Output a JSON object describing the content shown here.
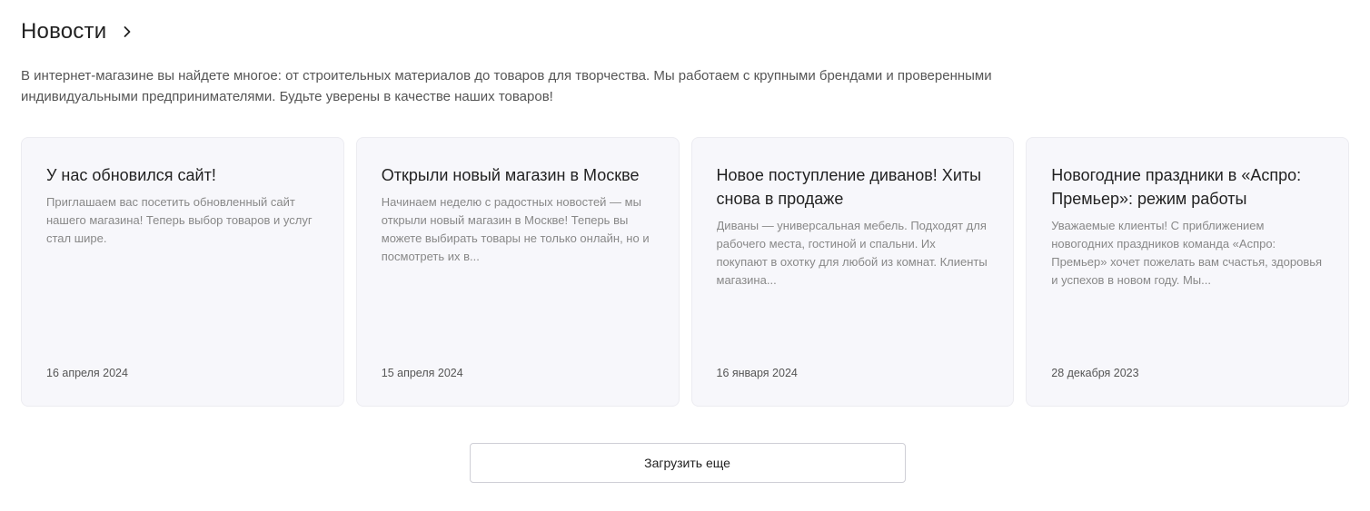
{
  "section": {
    "title": "Новости",
    "intro": "В интернет-магазине вы найдете многое: от строительных материалов до товаров для творчества. Мы работаем с крупными брендами и проверенными индивидуальными предпринимателями. Будьте уверены в качестве наших товаров!"
  },
  "icons": {
    "header_arrow": "chevron-right-icon"
  },
  "news": [
    {
      "title": "У нас обновился сайт!",
      "text": "Приглашаем вас посетить обновленный сайт нашего магазина! Теперь выбор товаров и услуг стал шире.",
      "date": "16 апреля 2024"
    },
    {
      "title": "Открыли новый магазин в Москве",
      "text": "Начинаем неделю с радостных новостей — мы открыли новый магазин в Москве! Теперь вы можете выбирать товары не только онлайн, но и посмотреть их в...",
      "date": "15 апреля 2024"
    },
    {
      "title": "Новое поступление диванов! Хиты снова в продаже",
      "text": "Диваны — универсальная мебель. Подходят для рабочего места, гостиной и спальни. Их покупают в охотку для любой из комнат. Клиенты магазина...",
      "date": "16 января 2024"
    },
    {
      "title": "Новогодние праздники в «Аспро: Премьер»: режим работы",
      "text": "Уважаемые клиенты! С приближением новогодних праздников команда «Аспро: Премьер» хочет пожелать вам счастья, здоровья и успехов в новом году. Мы...",
      "date": "28 декабря 2023"
    }
  ],
  "load_more_label": "Загрузить еще",
  "colors": {
    "card_background": "#f7f7fb",
    "card_border": "#ececf1",
    "muted_text": "#888888"
  }
}
